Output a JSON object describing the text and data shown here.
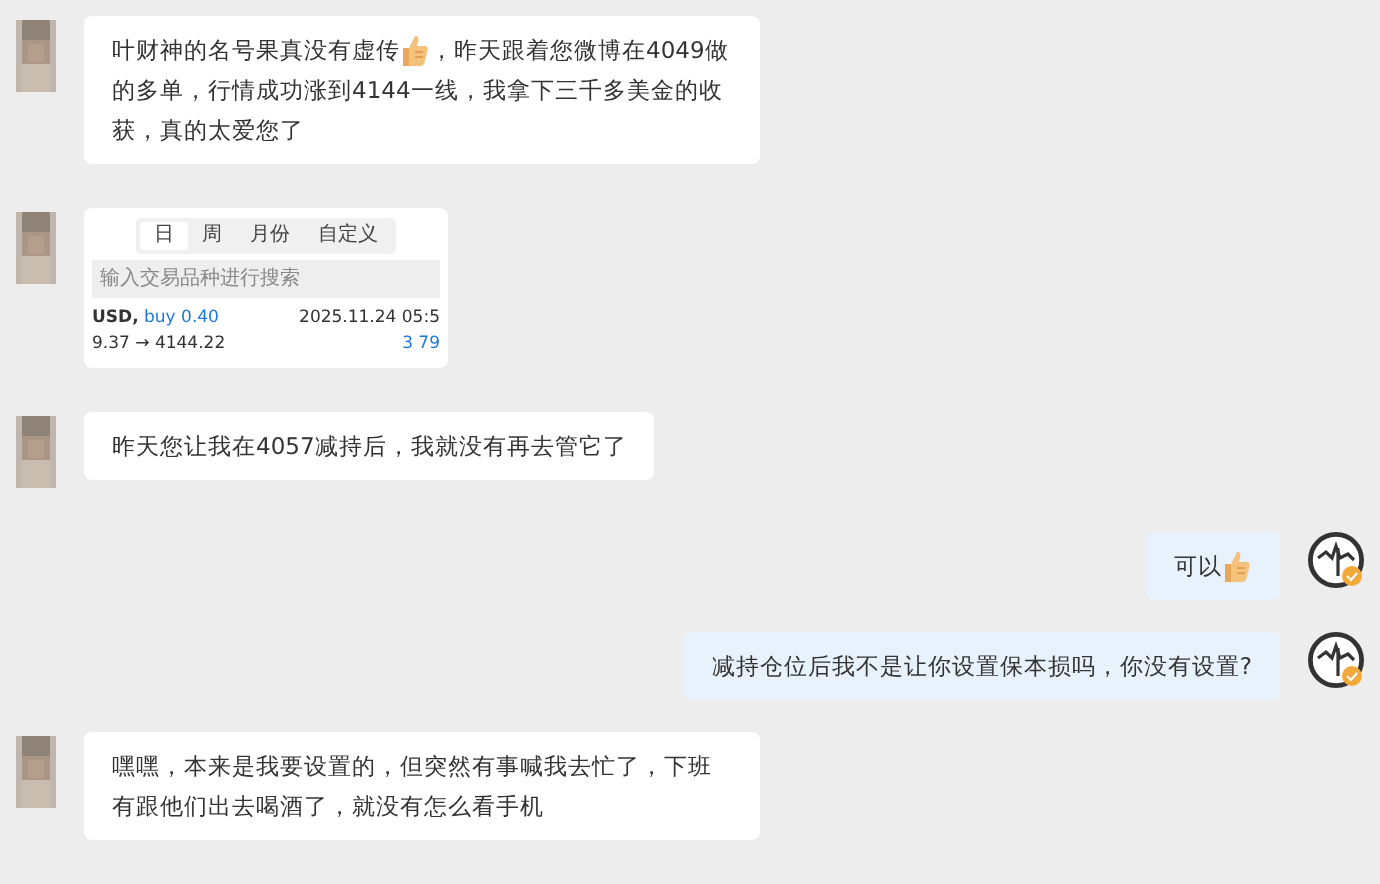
{
  "messages": [
    {
      "outgoing": false,
      "kind": "text",
      "lines": [
        [
          {
            "kind": "text",
            "text": "叶财神的名号果真没有虚传"
          },
          {
            "kind": "icon"
          },
          {
            "kind": "text",
            "text": "，昨天跟着您微博在4049做"
          }
        ],
        [
          {
            "kind": "text",
            "text": "的多单，行情成功涨到4144一线，我拿下三千多美金的收获，真的太爱您了"
          }
        ]
      ]
    },
    {
      "outgoing": false,
      "kind": "image",
      "screenshot": {
        "tabs": [
          {
            "label": "日",
            "selected": true
          },
          {
            "label": "周",
            "selected": false
          },
          {
            "label": "月份",
            "selected": false
          },
          {
            "label": "自定义",
            "selected": false
          }
        ],
        "search": {
          "placeholder": "输入交易品种进行搜索"
        },
        "trade": {
          "symbol": "USD,",
          "action": "buy 0.40",
          "time": "2025.11.24 05:5",
          "prices": "9.37 → 4144.22",
          "profit": "3 79"
        }
      }
    },
    {
      "outgoing": false,
      "kind": "text",
      "lines": [
        [
          {
            "kind": "text",
            "text": "昨天您让我在4057减持后，我就没有再去管它了"
          }
        ]
      ]
    },
    {
      "outgoing": true,
      "kind": "text",
      "lines": [
        [
          {
            "kind": "text",
            "text": "可以"
          },
          {
            "kind": "icon"
          }
        ]
      ]
    },
    {
      "outgoing": true,
      "kind": "text",
      "lines": [
        [
          {
            "kind": "text",
            "text": "减持仓位后我不是让你设置保本损吗，你没有设置?"
          }
        ]
      ]
    },
    {
      "outgoing": false,
      "kind": "text",
      "lines": [
        [
          {
            "kind": "text",
            "text": "嘿嘿，本来是我要设置的，但突然有事喊我去忙了，下班有跟他们出去喝酒了，就没有怎么看手机"
          }
        ]
      ]
    }
  ]
}
